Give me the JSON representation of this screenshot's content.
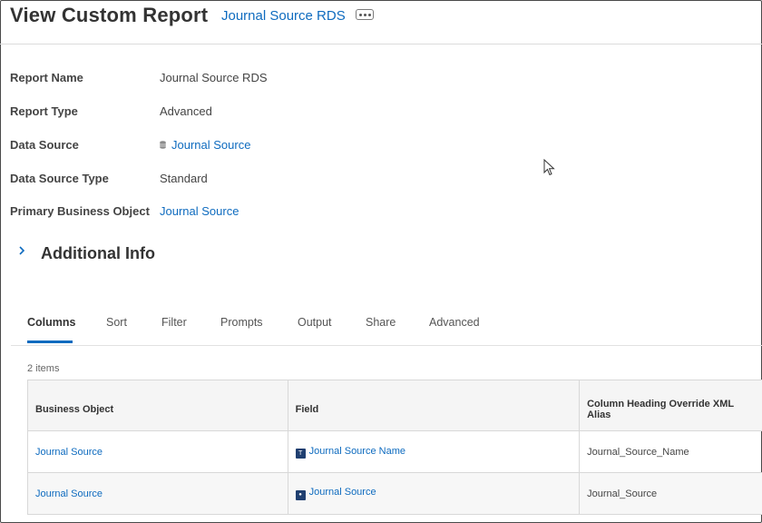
{
  "header": {
    "title": "View Custom Report",
    "report_link": "Journal Source RDS"
  },
  "details": {
    "report_name": {
      "label": "Report Name",
      "value": "Journal Source RDS"
    },
    "report_type": {
      "label": "Report Type",
      "value": "Advanced"
    },
    "data_source": {
      "label": "Data Source",
      "value": "Journal Source"
    },
    "data_source_type": {
      "label": "Data Source Type",
      "value": "Standard"
    },
    "primary_business_object": {
      "label": "Primary Business Object",
      "value": "Journal Source"
    }
  },
  "additional_info": {
    "title": "Additional Info"
  },
  "tabs": [
    {
      "label": "Columns"
    },
    {
      "label": "Sort"
    },
    {
      "label": "Filter"
    },
    {
      "label": "Prompts"
    },
    {
      "label": "Output"
    },
    {
      "label": "Share"
    },
    {
      "label": "Advanced"
    }
  ],
  "table": {
    "item_count": "2 items",
    "headers": [
      "Business Object",
      "Field",
      "Column Heading Override XML Alias"
    ],
    "rows": [
      {
        "business_object": "Journal Source",
        "field_icon": "T",
        "field": "Journal Source Name",
        "alias": "Journal_Source_Name"
      },
      {
        "business_object": "Journal Source",
        "field_icon": "●",
        "field": "Journal Source",
        "alias": "Journal_Source"
      }
    ]
  },
  "colors": {
    "link": "#0e6bbf",
    "tab_active": "#0e6bbf",
    "icon_bg": "#1f3f70"
  },
  "icons": [
    "more-dots-icon",
    "database-icon",
    "chevron-right-icon",
    "text-field-icon",
    "instance-field-icon",
    "mouse-cursor-icon"
  ]
}
